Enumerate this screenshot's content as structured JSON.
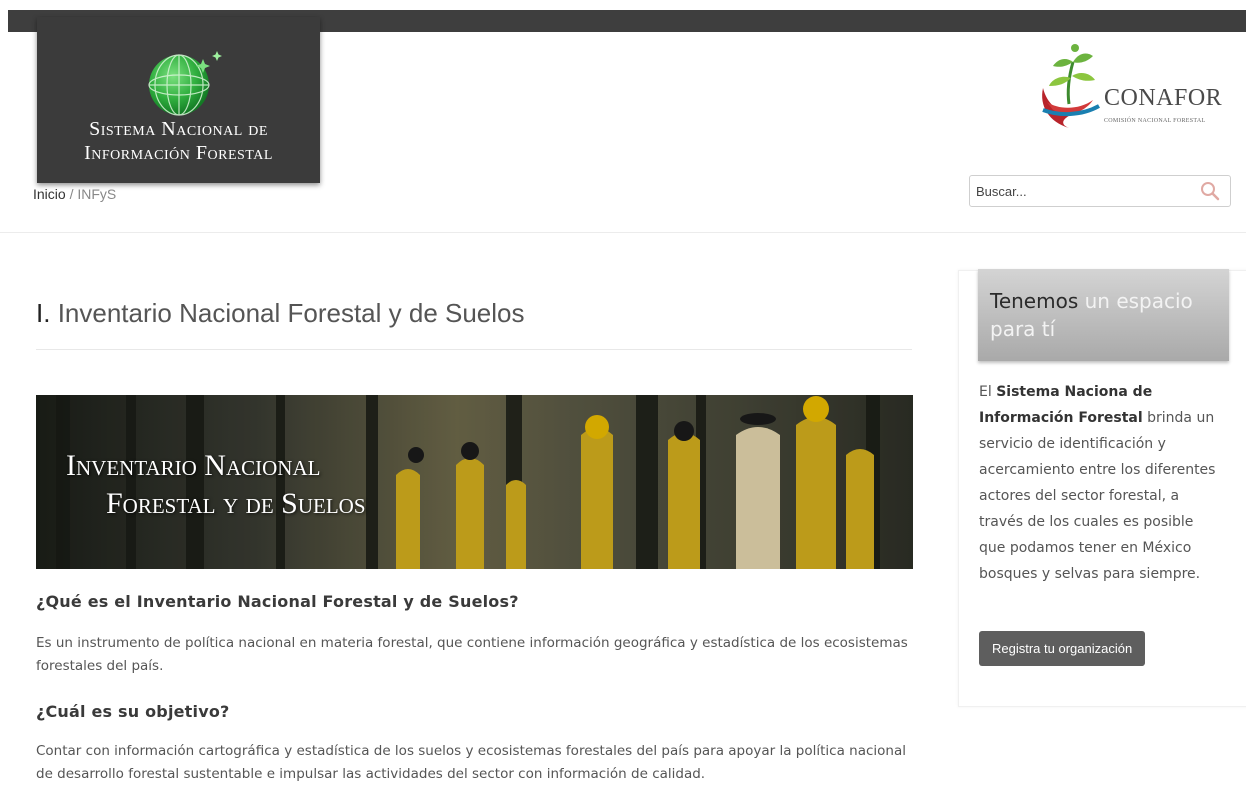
{
  "header": {
    "logo_line1": "Sistema Nacional de",
    "logo_line2": "Información Forestal",
    "partner_name": "CONAFOR",
    "partner_sub": "COMISIÓN NACIONAL FORESTAL"
  },
  "breadcrumb": {
    "home": "Inicio",
    "separator": "/",
    "current": "INFyS"
  },
  "search": {
    "placeholder": "Buscar...",
    "icon": "search-icon"
  },
  "main": {
    "title_roman": "I.",
    "title_text": "Inventario Nacional Forestal y de Suelos",
    "banner_line1": "Inventario Nacional",
    "banner_line2": "Forestal y de Suelos",
    "q1": "¿Qué es el Inventario Nacional Forestal y de Suelos?",
    "p1": "Es un instrumento de política nacional en materia forestal, que contiene información geográfica y estadística de los ecosistemas forestales del país.",
    "q2": "¿Cuál es su objetivo?",
    "p2": "Contar con información cartográfica y estadística de los suelos y ecosistemas forestales del país para apoyar la política nacional de desarrollo forestal sustentable e impulsar las actividades del sector con información de calidad."
  },
  "sidebar": {
    "promo_strong": "Tenemos",
    "promo_rest": "un espacio para tí",
    "text_intro": "El",
    "text_bold": "Sistema Naciona de Información Forestal",
    "text_rest": "brinda un servicio de identificación y acercamiento entre los diferentes actores del sector forestal, a través de los cuales es posible que podamos tener en México bosques y selvas para siempre.",
    "button_label": "Registra tu organización"
  },
  "colors": {
    "header_bar": "#3e3e3e",
    "logo_bg": "#3b3b3b",
    "button_bg": "#5e5e5e",
    "globe_green": "#2fae3e"
  }
}
